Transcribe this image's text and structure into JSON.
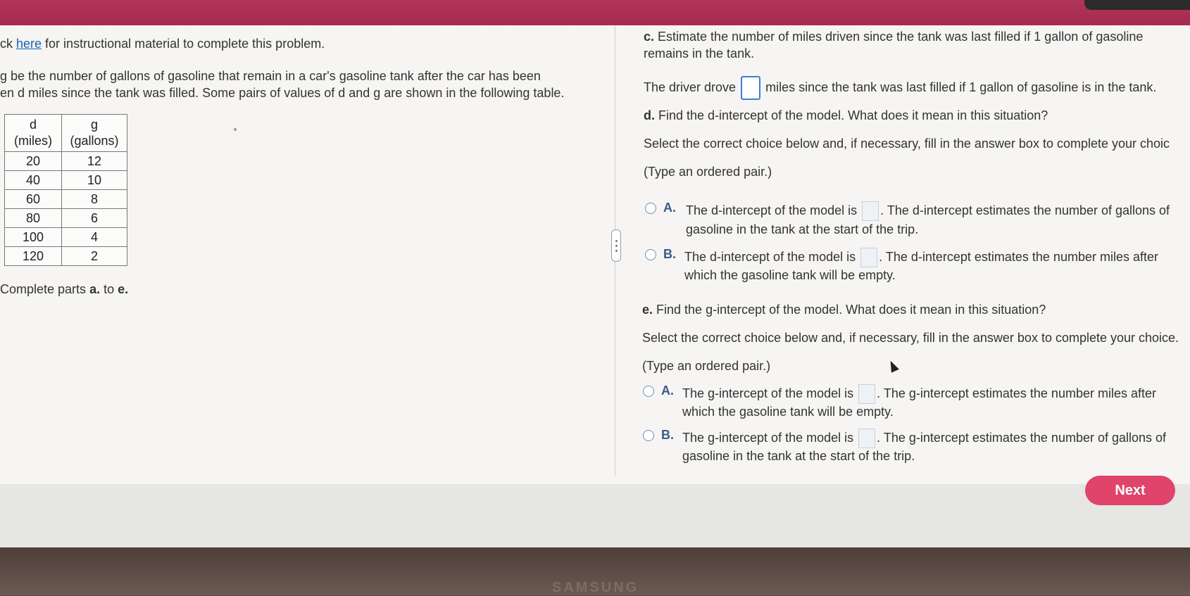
{
  "left": {
    "intro_prefix": "ck ",
    "intro_link": "here",
    "intro_suffix": " for instructional material to complete this problem.",
    "def_line1": "g be the number of gallons of gasoline that remain in a car's gasoline tank after the car has been",
    "def_line2": "en d miles since the tank was filled. Some pairs of values of d and g are shown in the following table.",
    "table": {
      "headers": [
        [
          "d",
          "(miles)"
        ],
        [
          "g",
          "(gallons)"
        ]
      ],
      "rows": [
        [
          "20",
          "12"
        ],
        [
          "40",
          "10"
        ],
        [
          "60",
          "8"
        ],
        [
          "80",
          "6"
        ],
        [
          "100",
          "4"
        ],
        [
          "120",
          "2"
        ]
      ]
    },
    "complete_prefix": "Complete parts ",
    "complete_a": "a.",
    "complete_mid": " to ",
    "complete_e": "e."
  },
  "right": {
    "c_label": "c.",
    "c_line1": "Estimate the number of miles driven since the tank was last filled if 1 gallon of gasoline",
    "c_line2": "remains in the tank.",
    "c_answer_prefix": "The driver drove",
    "c_answer_suffix": "miles since the tank was last filled if 1 gallon of gasoline is in the tank.",
    "d_label": "d.",
    "d_question": "Find the d-intercept of the model. What does it mean in this situation?",
    "d_select": "Select the correct choice below and, if necessary, fill in the answer box to complete your choic",
    "d_hint": "(Type an ordered pair.)",
    "d_choices": [
      {
        "letter": "A.",
        "pre": "The d-intercept of the model is",
        "post": ". The d-intercept estimates the number of gallons of",
        "line2": "gasoline in the tank at the start of the trip."
      },
      {
        "letter": "B.",
        "pre": "The d-intercept of the model is",
        "post": ". The d-intercept estimates the number miles after",
        "line2": "which the gasoline tank will be empty."
      }
    ],
    "e_label": "e.",
    "e_question": "Find the g-intercept of the model. What does it mean in this situation?",
    "e_select": "Select the correct choice below and, if necessary, fill in the answer box to complete your choice.",
    "e_hint": "(Type an ordered pair.)",
    "e_choices": [
      {
        "letter": "A.",
        "pre": "The g-intercept of the model is",
        "post": ". The g-intercept estimates the number miles after",
        "line2": "which the gasoline tank will be empty."
      },
      {
        "letter": "B.",
        "pre": "The g-intercept of the model is",
        "post": ". The g-intercept estimates the number of gallons of",
        "line2": "gasoline in the tank at the start of the trip."
      }
    ]
  },
  "footer": {
    "next_label": "Next"
  },
  "bezel": {
    "brand": "SAMSUNG"
  },
  "colors": {
    "accent": "#e0446b",
    "topbar": "#a52b50",
    "link": "#1a5fb4"
  }
}
